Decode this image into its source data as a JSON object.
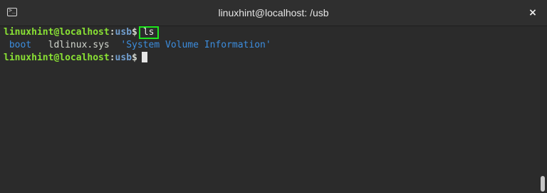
{
  "window": {
    "title": "linuxhint@localhost: /usb",
    "close_glyph": "×"
  },
  "icons": {
    "terminal": "terminal-icon",
    "close": "close-icon"
  },
  "terminal": {
    "prompt": {
      "user_host": "linuxhint@localhost",
      "colon": ":",
      "path": "usb",
      "dollar": "$"
    },
    "command": "ls",
    "ls_output": {
      "dir1": "boot",
      "file1": "ldlinux.sys",
      "dir2": "'System Volume Information'"
    }
  },
  "colors": {
    "prompt_user": "#8ae234",
    "prompt_path": "#729fcf",
    "directory": "#3c8dde",
    "highlight_box": "#1ee61e"
  }
}
